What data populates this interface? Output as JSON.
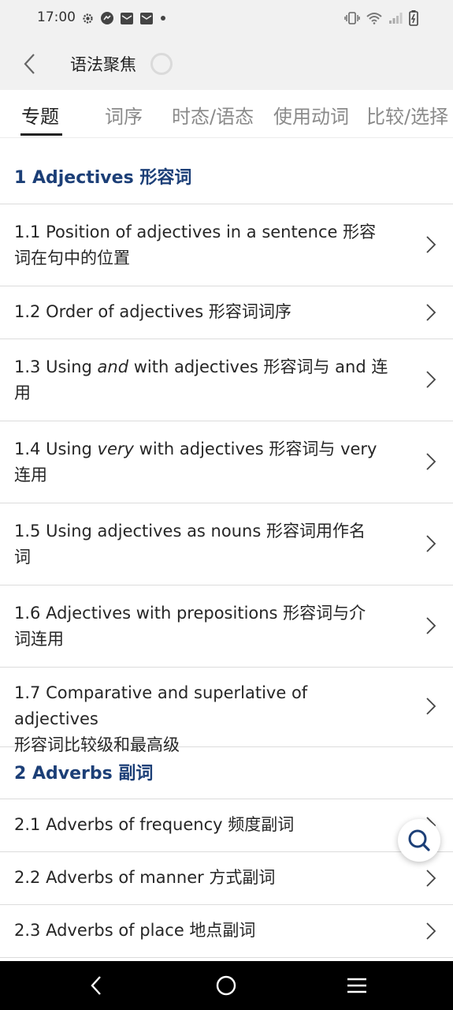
{
  "status_bar": {
    "time": "17:00",
    "left_icons": [
      "gear-icon",
      "messenger-icon",
      "mail-icon",
      "mail-icon",
      "dot-icon"
    ],
    "right_icons": [
      "vibrate-icon",
      "wifi-icon",
      "signal-icon",
      "battery-icon"
    ]
  },
  "app_bar": {
    "title": "语法聚焦"
  },
  "tabs": [
    {
      "label": "专题",
      "active": true
    },
    {
      "label": "词序",
      "active": false
    },
    {
      "label": "时态/语态",
      "active": false
    },
    {
      "label": "使用动词",
      "active": false
    },
    {
      "label": "比较/选择",
      "active": false
    }
  ],
  "sections": [
    {
      "title": "1 Adjectives 形容词",
      "items": [
        {
          "line1": "1.1 Position of adjectives in a sentence 形容",
          "line2": "词在句中的位置"
        },
        {
          "line1": "1.2 Order of adjectives 形容词词序",
          "line2": ""
        },
        {
          "pre": "1.3 Using ",
          "em": "and",
          "post": " with adjectives 形容词与 and 连",
          "line2": "用"
        },
        {
          "pre": "1.4 Using ",
          "em": "very",
          "post": " with adjectives 形容词与 very",
          "line2": "连用"
        },
        {
          "line1": "1.5 Using adjectives as nouns 形容词用作名",
          "line2": "词"
        },
        {
          "line1": "1.6 Adjectives with prepositions 形容词与介",
          "line2": "词连用"
        },
        {
          "line1": "1.7 Comparative and superlative of adjectives",
          "line2": "形容词比较级和最高级"
        }
      ]
    },
    {
      "title": "2 Adverbs 副词",
      "items": [
        {
          "line1": "2.1 Adverbs of frequency 频度副词"
        },
        {
          "line1": "2.2 Adverbs of manner 方式副词"
        },
        {
          "line1": "2.3 Adverbs of place 地点副词"
        }
      ]
    }
  ],
  "colors": {
    "section_title": "#1c3f77",
    "app_bar_bg": "#f1f1f1",
    "nav_bar_bg": "#000000"
  }
}
